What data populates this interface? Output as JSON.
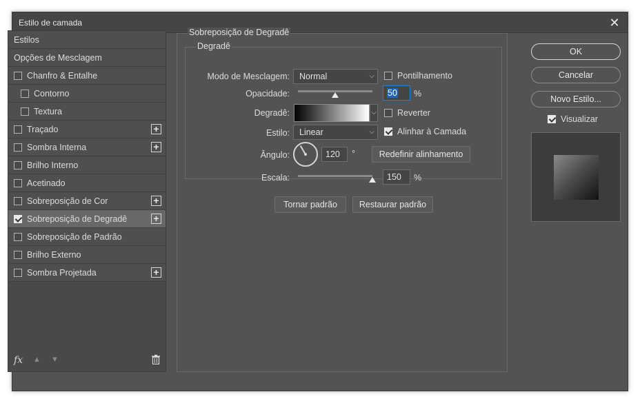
{
  "window": {
    "title": "Estilo de camada"
  },
  "styles_list": [
    {
      "label": "Estilos",
      "checkbox": false,
      "indent": false,
      "plus": false,
      "checked": false,
      "selected": false
    },
    {
      "label": "Opções de Mesclagem",
      "checkbox": false,
      "indent": false,
      "plus": false,
      "checked": false,
      "selected": false
    },
    {
      "label": "Chanfro & Entalhe",
      "checkbox": true,
      "indent": false,
      "plus": false,
      "checked": false,
      "selected": false
    },
    {
      "label": "Contorno",
      "checkbox": true,
      "indent": true,
      "plus": false,
      "checked": false,
      "selected": false
    },
    {
      "label": "Textura",
      "checkbox": true,
      "indent": true,
      "plus": false,
      "checked": false,
      "selected": false
    },
    {
      "label": "Traçado",
      "checkbox": true,
      "indent": false,
      "plus": true,
      "checked": false,
      "selected": false
    },
    {
      "label": "Sombra Interna",
      "checkbox": true,
      "indent": false,
      "plus": true,
      "checked": false,
      "selected": false
    },
    {
      "label": "Brilho Interno",
      "checkbox": true,
      "indent": false,
      "plus": false,
      "checked": false,
      "selected": false
    },
    {
      "label": "Acetinado",
      "checkbox": true,
      "indent": false,
      "plus": false,
      "checked": false,
      "selected": false
    },
    {
      "label": "Sobreposição de Cor",
      "checkbox": true,
      "indent": false,
      "plus": true,
      "checked": false,
      "selected": false
    },
    {
      "label": "Sobreposição de Degradê",
      "checkbox": true,
      "indent": false,
      "plus": true,
      "checked": true,
      "selected": true
    },
    {
      "label": "Sobreposição de Padrão",
      "checkbox": true,
      "indent": false,
      "plus": false,
      "checked": false,
      "selected": false
    },
    {
      "label": "Brilho Externo",
      "checkbox": true,
      "indent": false,
      "plus": false,
      "checked": false,
      "selected": false
    },
    {
      "label": "Sombra Projetada",
      "checkbox": true,
      "indent": false,
      "plus": true,
      "checked": false,
      "selected": false
    }
  ],
  "footer": {
    "fx_label": "fx"
  },
  "panel": {
    "group_title": "Sobreposição de Degradê",
    "sub_title": "Degradê",
    "blend_mode": {
      "label": "Modo de Mesclagem:",
      "value": "Normal"
    },
    "dither": {
      "label": "Pontilhamento",
      "checked": false
    },
    "opacity": {
      "label": "Opacidade:",
      "value": "50",
      "unit": "%",
      "slider_fraction": 0.5
    },
    "gradient": {
      "label": "Degradê:"
    },
    "reverse": {
      "label": "Reverter",
      "checked": false
    },
    "style": {
      "label": "Estilo:",
      "value": "Linear"
    },
    "align_layer": {
      "label": "Alinhar à Camada",
      "checked": true
    },
    "angle": {
      "label": "Ângulo:",
      "value": "120",
      "unit": "°"
    },
    "reset_alignment_label": "Redefinir alinhamento",
    "scale": {
      "label": "Escala:",
      "value": "150",
      "unit": "%",
      "slider_fraction": 1.0
    },
    "make_default_label": "Tornar padrão",
    "reset_default_label": "Restaurar padrão"
  },
  "right": {
    "ok_label": "OK",
    "cancel_label": "Cancelar",
    "new_style_label": "Novo Estilo...",
    "preview": {
      "label": "Visualizar",
      "checked": true
    }
  },
  "colors": {
    "dialog_bg": "#535353",
    "selected_item": "#686868",
    "focus": "#2f7bd1"
  }
}
